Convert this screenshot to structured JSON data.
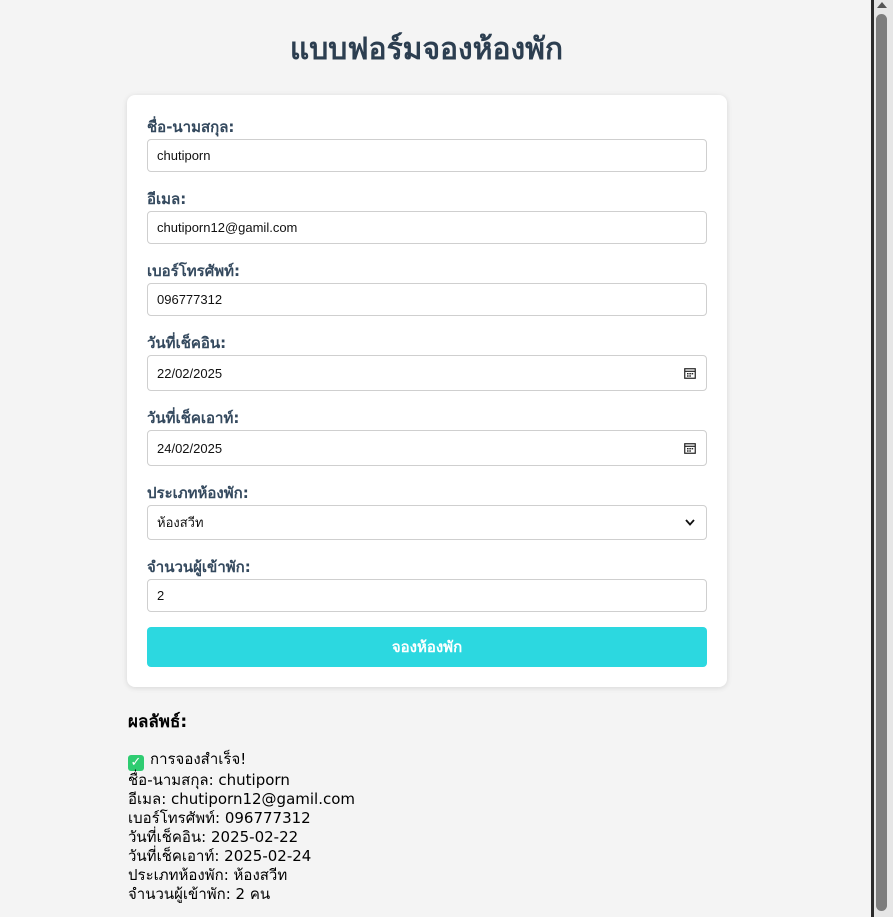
{
  "page": {
    "title": "แบบฟอร์มจองห้องพัก"
  },
  "form": {
    "fullname": {
      "label": "ชื่อ-นามสกุล:",
      "value": "chutiporn"
    },
    "email": {
      "label": "อีเมล:",
      "value": "chutiporn12@gamil.com"
    },
    "phone": {
      "label": "เบอร์โทรศัพท์:",
      "value": "096777312"
    },
    "checkin": {
      "label": "วันที่เช็คอิน:",
      "value": "22/02/2025",
      "icon": "calendar-icon"
    },
    "checkout": {
      "label": "วันที่เช็คเอาท์:",
      "value": "24/02/2025",
      "icon": "calendar-icon"
    },
    "room_type": {
      "label": "ประเภทห้องพัก:",
      "value": "ห้องสวีท",
      "icon": "chevron-down-icon"
    },
    "guests": {
      "label": "จำนวนผู้เข้าพัก:",
      "value": "2"
    },
    "submit_label": "จองห้องพัก"
  },
  "result": {
    "title": "ผลลัพธ์:",
    "success": "การจองสำเร็จ!",
    "lines": [
      "ชื่อ-นามสกุล: chutiporn",
      "อีเมล: chutiporn12@gamil.com",
      "เบอร์โทรศัพท์: 096777312",
      "วันที่เช็คอิน: 2025-02-22",
      "วันที่เช็คเอาท์: 2025-02-24",
      "ประเภทห้องพัก: ห้องสวีท",
      "จำนวนผู้เข้าพัก: 2 คน"
    ]
  },
  "colors": {
    "background": "#f4f4f4",
    "title": "#2c3e50",
    "label": "#34495e",
    "button": "#2cd8e0",
    "success_check": "#2ecc71"
  }
}
